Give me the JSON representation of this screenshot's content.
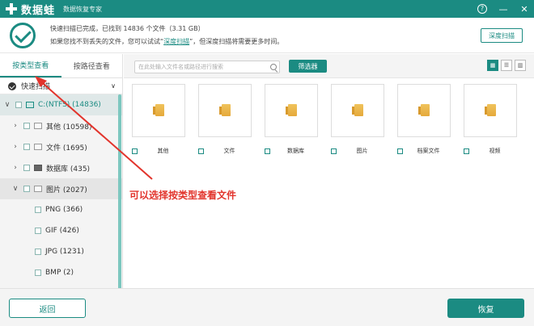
{
  "titlebar": {
    "app_name": "数据蛙",
    "subtitle": "数据恢复专家",
    "help": "?",
    "minimize": "—",
    "close": "✕"
  },
  "status": {
    "line1": "快速扫描已完成，已找到 14836 个文件（3.31 GB）",
    "line2_prefix": "如果您找不到丢失的文件，您可以试试“",
    "line2_link": "深度扫描",
    "line2_suffix": "”，但深度扫描将需要更多时间。",
    "deep_scan_button": "深度扫描"
  },
  "left": {
    "tabs": [
      {
        "label": "按类型查看",
        "active": true
      },
      {
        "label": "按路径查看",
        "active": false
      }
    ],
    "quick_scan": "快速扫描",
    "tree": [
      {
        "label": "C:(NTFS) (14836)",
        "level": 0,
        "chev": "∨"
      },
      {
        "label": "其他 (10598)",
        "level": 1,
        "chev": "›"
      },
      {
        "label": "文件 (1695)",
        "level": 1,
        "chev": "›"
      },
      {
        "label": "数据库 (435)",
        "level": 1,
        "chev": "›"
      },
      {
        "label": "图片 (2027)",
        "level": 1,
        "chev": "∨"
      },
      {
        "label": "PNG (366)",
        "level": 2
      },
      {
        "label": "GIF (426)",
        "level": 2
      },
      {
        "label": "JPG (1231)",
        "level": 2
      },
      {
        "label": "BMP (2)",
        "level": 2
      }
    ]
  },
  "toolbar": {
    "search_placeholder": "在此处输入文件名或路径进行搜索",
    "filter_button": "筛选器",
    "view_grid": "▦",
    "view_list": "☰",
    "view_detail": "▥"
  },
  "files": [
    {
      "label": "其他"
    },
    {
      "label": "文件"
    },
    {
      "label": "数据库"
    },
    {
      "label": "图片"
    },
    {
      "label": "档案文件"
    },
    {
      "label": "视频"
    }
  ],
  "annotation": "可以选择按类型查看文件",
  "footer": {
    "back_button": "返回",
    "restore_button": "恢复"
  },
  "colors": {
    "accent": "#1b8b82",
    "annotation": "#e2342c"
  }
}
